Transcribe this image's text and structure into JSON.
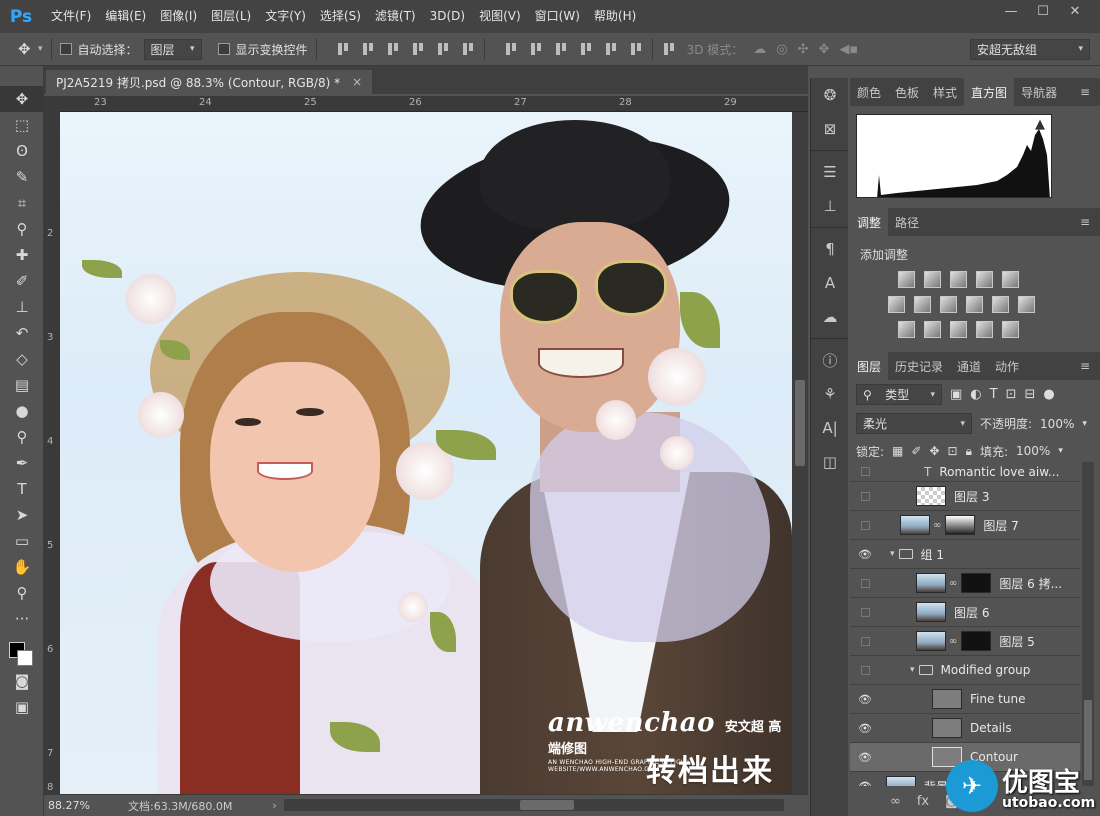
{
  "app": {
    "logo": "Ps",
    "menu": [
      "文件(F)",
      "编辑(E)",
      "图像(I)",
      "图层(L)",
      "文字(Y)",
      "选择(S)",
      "滤镜(T)",
      "3D(D)",
      "视图(V)",
      "窗口(W)",
      "帮助(H)"
    ],
    "window_controls": [
      "—",
      "☐",
      "✕"
    ]
  },
  "options": {
    "auto_select_label": "自动选择：",
    "auto_select_target": "图层",
    "show_transform_label": "显示变换控件",
    "mode_3d_label": "3D 模式：",
    "workspace": "安超无敌组"
  },
  "document": {
    "tab_title": "PJ2A5219 拷贝.psd @ 88.3% (Contour, RGB/8) *",
    "close": "×",
    "ruler_top": [
      "23",
      "24",
      "25",
      "26",
      "27",
      "28",
      "29"
    ],
    "ruler_left": [
      "2",
      "3",
      "4",
      "5",
      "6",
      "7",
      "8"
    ],
    "watermark_brand": "anwenchao",
    "watermark_cn": "安文超 高端修图",
    "watermark_sub": "AN WENCHAO HIGH-END GRAPHIC OFFICIAL WEBSITE/WWW.ANWENCHAO.COM",
    "caption": "转档出来"
  },
  "status": {
    "zoom": "88.27%",
    "doc_info": "文档:63.3M/680.0M",
    "arrow": "›"
  },
  "tools": [
    "move-tool",
    "marquee-tool",
    "lasso-tool",
    "quick-select-tool",
    "crop-tool",
    "eyedropper-tool",
    "healing-brush-tool",
    "brush-tool",
    "clone-stamp-tool",
    "history-brush-tool",
    "eraser-tool",
    "gradient-tool",
    "blur-tool",
    "dodge-tool",
    "pen-tool",
    "type-tool",
    "path-select-tool",
    "rectangle-tool",
    "hand-tool",
    "zoom-tool",
    "more-tools"
  ],
  "panels": {
    "top_tabs": [
      "颜色",
      "色板",
      "样式",
      "直方图",
      "导航器"
    ],
    "top_active": "直方图",
    "adj_tabs": [
      "调整",
      "路径"
    ],
    "adj_title": "添加调整",
    "layer_tabs": [
      "图层",
      "历史记录",
      "通道",
      "动作"
    ],
    "kind_filter": "类型",
    "blend_mode": "柔光",
    "opacity_label": "不透明度:",
    "opacity_value": "100%",
    "lock_label": "锁定:",
    "fill_label": "填充:",
    "fill_value": "100%"
  },
  "layers": [
    {
      "name": "Romantic love  aiw...",
      "visible": false,
      "type": "text"
    },
    {
      "name": "图层 3",
      "visible": false,
      "type": "checker"
    },
    {
      "name": "图层 7",
      "visible": false,
      "type": "grad-mask"
    },
    {
      "name": "组 1",
      "visible": true,
      "type": "group"
    },
    {
      "name": "图层 6 拷...",
      "visible": false,
      "type": "mask"
    },
    {
      "name": "图层 6",
      "visible": false,
      "type": "plain"
    },
    {
      "name": "图层 5",
      "visible": false,
      "type": "mask"
    },
    {
      "name": "Modified group",
      "visible": false,
      "type": "subgroup"
    },
    {
      "name": "Fine tune",
      "visible": true,
      "type": "gray"
    },
    {
      "name": "Details",
      "visible": true,
      "type": "gray"
    },
    {
      "name": "Contour",
      "visible": true,
      "type": "gray",
      "selected": true
    },
    {
      "name": "背景",
      "visible": true,
      "type": "plain"
    }
  ],
  "site_logo": {
    "cn": "优图宝",
    "url": "utobao.com"
  }
}
